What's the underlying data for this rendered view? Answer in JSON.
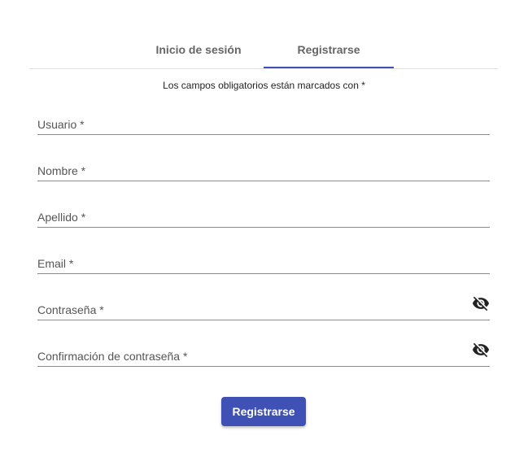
{
  "tabs": [
    {
      "label": "Inicio de sesión",
      "active": false
    },
    {
      "label": "Registrarse",
      "active": true
    }
  ],
  "required_note": "Los campos obligatorios están marcados con *",
  "fields": {
    "username": {
      "label": "Usuario *",
      "value": ""
    },
    "first_name": {
      "label": "Nombre *",
      "value": ""
    },
    "last_name": {
      "label": "Apellido *",
      "value": ""
    },
    "email": {
      "label": "Email *",
      "value": ""
    },
    "password": {
      "label": "Contraseña *",
      "value": "",
      "icon": "eye-off-icon"
    },
    "password_confirm": {
      "label": "Confirmación de contraseña *",
      "value": "",
      "icon": "eye-off-icon"
    }
  },
  "submit_label": "Registrarse",
  "colors": {
    "accent": "#3f51b5",
    "underline": "#8a8a8a",
    "divider": "#e0e0e0"
  }
}
